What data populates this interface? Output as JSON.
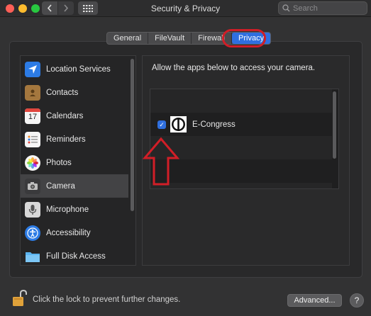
{
  "window": {
    "title": "Security & Privacy"
  },
  "search": {
    "placeholder": "Search"
  },
  "tabs": [
    {
      "label": "General",
      "active": false
    },
    {
      "label": "FileVault",
      "active": false
    },
    {
      "label": "Firewall",
      "active": false
    },
    {
      "label": "Privacy",
      "active": true
    }
  ],
  "sidebar": {
    "items": [
      {
        "label": "Location Services",
        "icon": "location-arrow-icon",
        "selected": false
      },
      {
        "label": "Contacts",
        "icon": "contacts-book-icon",
        "selected": false
      },
      {
        "label": "Calendars",
        "icon": "calendar-icon",
        "icon_text": "17",
        "selected": false
      },
      {
        "label": "Reminders",
        "icon": "reminders-list-icon",
        "selected": false
      },
      {
        "label": "Photos",
        "icon": "photos-flower-icon",
        "selected": false
      },
      {
        "label": "Camera",
        "icon": "camera-icon",
        "selected": true
      },
      {
        "label": "Microphone",
        "icon": "microphone-icon",
        "selected": false
      },
      {
        "label": "Accessibility",
        "icon": "accessibility-icon",
        "selected": false
      },
      {
        "label": "Full Disk Access",
        "icon": "folder-icon",
        "selected": false
      }
    ]
  },
  "main": {
    "prompt": "Allow the apps below to access your camera.",
    "apps": [
      {
        "name": "E-Congress",
        "checked": true,
        "icon": "e-congress-logo-icon"
      }
    ]
  },
  "footer": {
    "lock_text": "Click the lock to prevent further changes.",
    "advanced_label": "Advanced...",
    "help_label": "?"
  },
  "colors": {
    "accent": "#2f6fdf",
    "annotation_red": "#d11e27",
    "background": "#323233"
  }
}
